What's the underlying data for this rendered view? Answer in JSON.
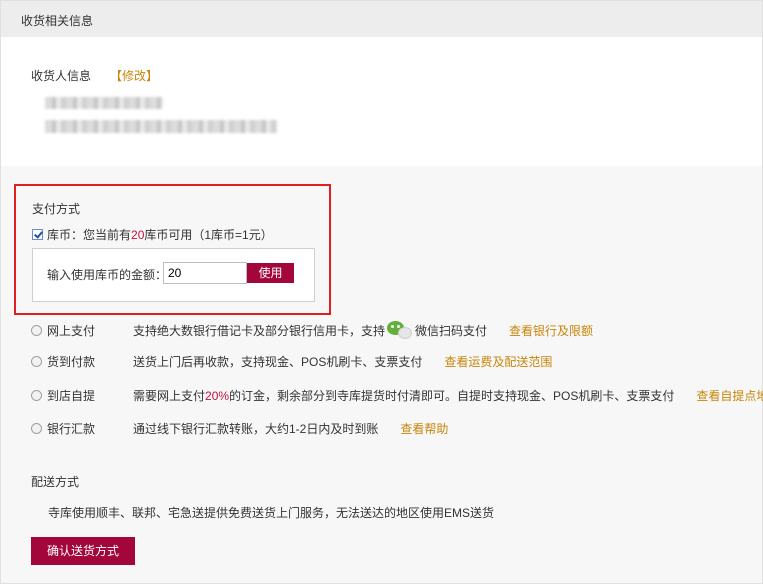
{
  "header": {
    "title": "收货相关信息"
  },
  "receiver": {
    "title": "收货人信息",
    "modify_label": "【修改】"
  },
  "payment": {
    "title": "支付方式",
    "coin": {
      "prefix": "库币：您当前有",
      "amount": "20",
      "suffix": "库币可用（1库币=1元）",
      "checked": true,
      "input_label": "输入使用库币的金额：",
      "input_value": "20",
      "use_button": "使用"
    },
    "options": [
      {
        "name": "网上支付",
        "desc": "支持绝大数银行借记卡及部分银行信用卡，支持",
        "desc2": "微信扫码支付",
        "link": "查看银行及限额",
        "icon": "wechat-icon"
      },
      {
        "name": "货到付款",
        "desc": "送货上门后再收款，支持现金、POS机刷卡、支票支付",
        "link": "查看运费及配送范围"
      },
      {
        "name": "到店自提",
        "desc_a": "需要网上支付",
        "pct": "20%",
        "desc_b": "的订金，剩余部分到寺库提货时付清即可。自提时支持现金、POS机刷卡、支票支付",
        "link": "查看自提点地址"
      },
      {
        "name": "银行汇款",
        "desc": "通过线下银行汇款转账，大约1-2日内及时到账",
        "link": "查看帮助"
      }
    ]
  },
  "shipping": {
    "title": "配送方式",
    "desc": "寺库使用顺丰、联邦、宅急送提供免费送货上门服务，无法送达的地区使用EMS送货",
    "confirm_button": "确认送货方式"
  },
  "colors": {
    "accent": "#a3063a",
    "link": "#c8860a",
    "highlight_border": "#e02020",
    "number": "#c1123c"
  }
}
